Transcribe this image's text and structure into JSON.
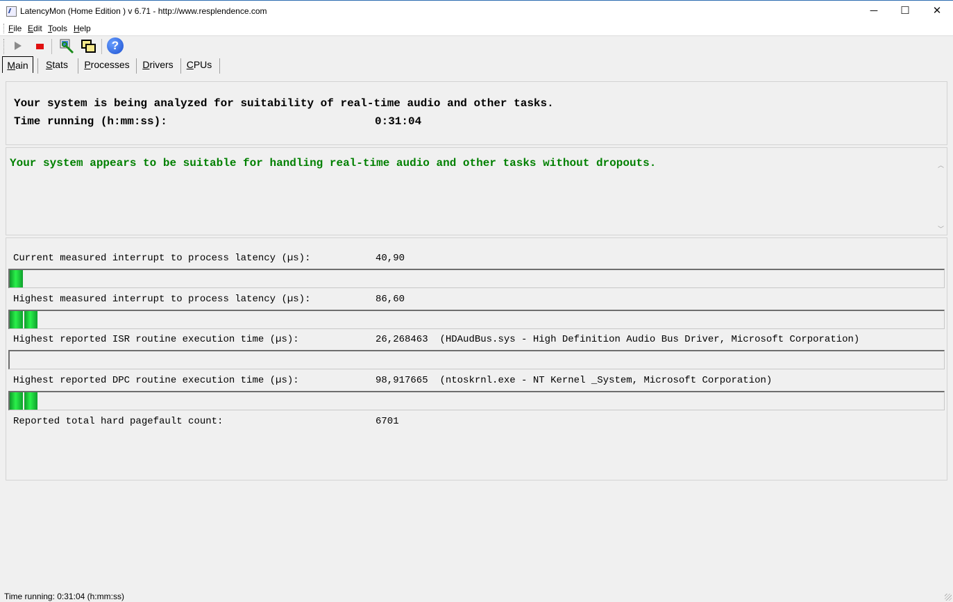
{
  "window": {
    "title": "LatencyMon  (Home Edition )  v 6.71 - http://www.resplendence.com",
    "minimize": "─",
    "maximize": "☐",
    "close": "✕"
  },
  "menu": {
    "items": [
      {
        "label": "File",
        "accel": "F",
        "rest": "ile"
      },
      {
        "label": "Edit",
        "accel": "E",
        "rest": "dit"
      },
      {
        "label": "Tools",
        "accel": "T",
        "rest": "ools"
      },
      {
        "label": "Help",
        "accel": "H",
        "rest": "elp"
      }
    ]
  },
  "toolbar": {
    "icons": [
      "play-icon",
      "stop-icon",
      "tools-icon",
      "windows-icon",
      "help-icon"
    ],
    "help_glyph": "?"
  },
  "tabs": [
    {
      "label": "Main",
      "accel": "M",
      "rest": "ain",
      "active": true
    },
    {
      "label": "Stats",
      "accel": "S",
      "rest": "tats",
      "active": false
    },
    {
      "label": "Processes",
      "accel": "P",
      "rest": "rocesses",
      "active": false
    },
    {
      "label": "Drivers",
      "accel": "D",
      "rest": "rivers",
      "active": false
    },
    {
      "label": "CPUs",
      "accel": "C",
      "rest": "PUs",
      "active": false
    }
  ],
  "header": {
    "analysis_text": "Your system is being analyzed for suitability of real-time audio and other tasks.",
    "time_label": "Time running (h:mm:ss):",
    "time_value": "0:31:04"
  },
  "result": {
    "message": "Your system appears to be suitable for handling real-time audio and other tasks without dropouts.",
    "color": "#008000"
  },
  "stats": [
    {
      "label": "Current measured interrupt to process latency (µs):",
      "value": "40,90",
      "detail": "",
      "bar_segments": 1
    },
    {
      "label": "Highest measured interrupt to process latency (µs):",
      "value": "86,60",
      "detail": "",
      "bar_segments": 2
    },
    {
      "label": "Highest reported ISR routine execution time (µs):",
      "value": "26,268463",
      "detail": "(HDAudBus.sys - High Definition Audio Bus Driver, Microsoft Corporation)",
      "bar_segments": 0
    },
    {
      "label": "Highest reported DPC routine execution time (µs):",
      "value": "98,917665",
      "detail": "(ntoskrnl.exe - NT Kernel _System, Microsoft Corporation)",
      "bar_segments": 2
    },
    {
      "label": "Reported total hard pagefault count:",
      "value": "6701",
      "detail": "",
      "bar_segments": 0
    }
  ],
  "statusbar": {
    "text": "Time running: 0:31:04  (h:mm:ss)"
  }
}
